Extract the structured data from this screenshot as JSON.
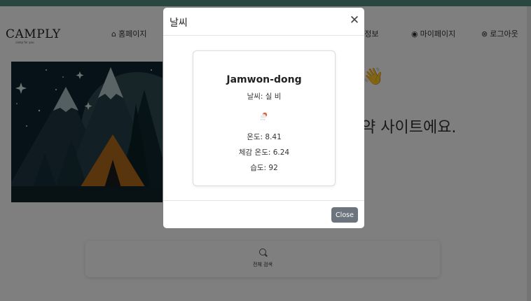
{
  "header": {
    "logo": "CAMPLY",
    "logo_sub": "camp for you",
    "nav": [
      {
        "label": "홈페이지",
        "icon": "home-icon"
      },
      {
        "label": "캠핑정보",
        "icon": ""
      },
      {
        "label": "마이페이지",
        "icon": "user-icon"
      },
      {
        "label": "로그아웃",
        "icon": "logout-icon"
      }
    ]
  },
  "hero": {
    "wave_emoji": "👋",
    "text": "약 사이트에요."
  },
  "search": {
    "label": "전체 검색"
  },
  "modal": {
    "title": "날씨",
    "close_icon": "✕",
    "city": "Jamwon-dong",
    "description": "날씨: 실 비",
    "temp": "온도: 8.41",
    "feels_like": "체감 온도: 6.24",
    "humidity": "습도: 92",
    "close_button": "Close"
  },
  "colors": {
    "accent": "#4f8f7e",
    "button": "#6c757d"
  }
}
